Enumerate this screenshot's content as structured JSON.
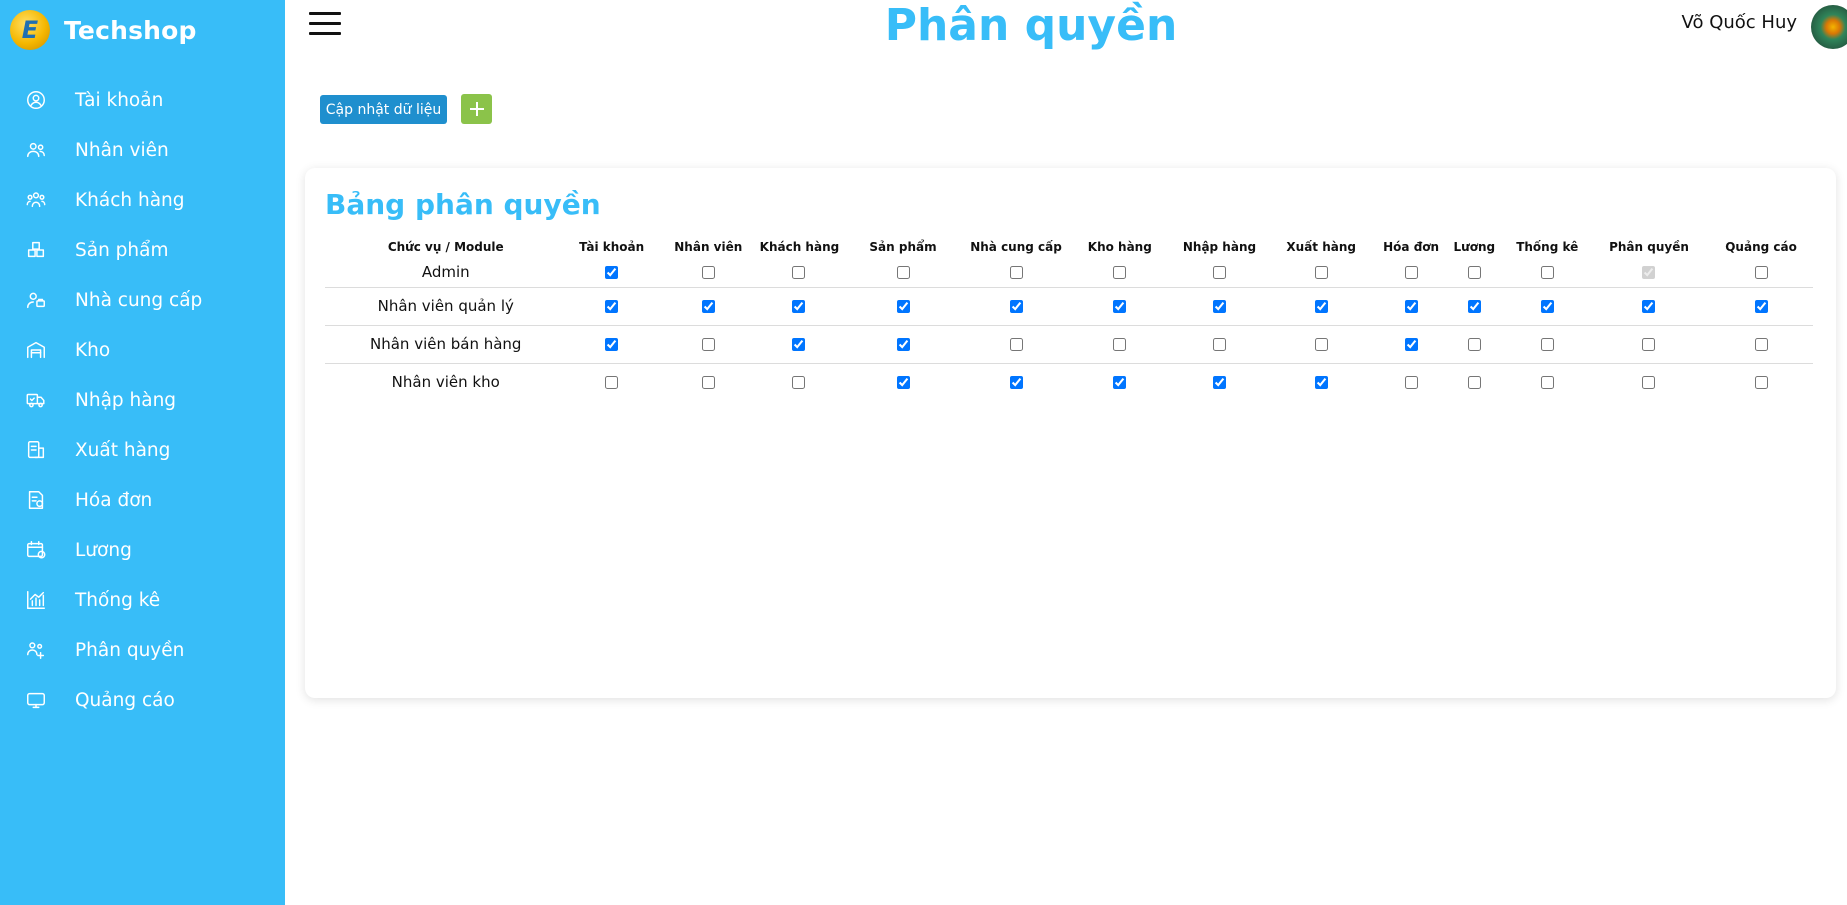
{
  "brand": {
    "name": "Techshop",
    "logo_letter": "E"
  },
  "sidebar": {
    "items": [
      {
        "label": "Tài khoản",
        "icon": "user-circle-icon"
      },
      {
        "label": "Nhân viên",
        "icon": "users-icon"
      },
      {
        "label": "Khách hàng",
        "icon": "customers-icon"
      },
      {
        "label": "Sản phẩm",
        "icon": "boxes-icon"
      },
      {
        "label": "Nhà cung cấp",
        "icon": "supplier-icon"
      },
      {
        "label": "Kho",
        "icon": "warehouse-icon"
      },
      {
        "label": "Nhập hàng",
        "icon": "truck-icon"
      },
      {
        "label": "Xuất hàng",
        "icon": "export-icon"
      },
      {
        "label": "Hóa đơn",
        "icon": "invoice-icon"
      },
      {
        "label": "Lương",
        "icon": "salary-icon"
      },
      {
        "label": "Thống kê",
        "icon": "chart-icon"
      },
      {
        "label": "Phân quyền",
        "icon": "permission-icon"
      },
      {
        "label": "Quảng cáo",
        "icon": "monitor-icon"
      }
    ]
  },
  "header": {
    "title": "Phân quyền",
    "user_name": "Võ Quốc Huy"
  },
  "toolbar": {
    "update_label": "Cập nhật dữ liệu",
    "add_symbol": "+"
  },
  "permissions": {
    "title": "Bảng phân quyền",
    "role_header": "Chức vụ / Module",
    "modules": [
      "Tài khoản",
      "Nhân viên",
      "Khách hàng",
      "Sản phẩm",
      "Nhà cung cấp",
      "Kho hàng",
      "Nhập hàng",
      "Xuất hàng",
      "Hóa đơn",
      "Lương",
      "Thống kê",
      "Phân quyền",
      "Quảng cáo"
    ],
    "roles": [
      {
        "name": "Admin",
        "checked": [
          true,
          false,
          false,
          false,
          false,
          false,
          false,
          false,
          false,
          false,
          false,
          true,
          false
        ],
        "disabled": [
          false,
          false,
          false,
          false,
          false,
          false,
          false,
          false,
          false,
          false,
          false,
          true,
          false
        ]
      },
      {
        "name": "Nhân viên quản lý",
        "checked": [
          true,
          true,
          true,
          true,
          true,
          true,
          true,
          true,
          true,
          true,
          true,
          true,
          true
        ]
      },
      {
        "name": "Nhân viên bán hàng",
        "checked": [
          true,
          false,
          true,
          true,
          false,
          false,
          false,
          false,
          true,
          false,
          false,
          false,
          false
        ]
      },
      {
        "name": "Nhân viên kho",
        "checked": [
          false,
          false,
          false,
          true,
          true,
          true,
          true,
          true,
          false,
          false,
          false,
          false,
          false
        ]
      }
    ]
  },
  "colors": {
    "accent": "#38bdf8",
    "button_blue": "#1f8fce",
    "button_green": "#8bc34a"
  }
}
